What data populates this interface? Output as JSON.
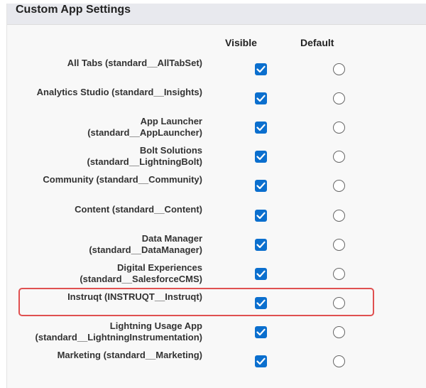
{
  "section": {
    "title": "Custom App Settings"
  },
  "columns": {
    "visible": "Visible",
    "default": "Default"
  },
  "apps": [
    {
      "line1": "All Tabs (standard__AllTabSet)",
      "line2": "",
      "visible": true,
      "default": false
    },
    {
      "line1": "Analytics Studio (standard__Insights)",
      "line2": "",
      "visible": true,
      "default": false
    },
    {
      "line1": "App Launcher",
      "line2": "(standard__AppLauncher)",
      "visible": true,
      "default": false
    },
    {
      "line1": "Bolt Solutions",
      "line2": "(standard__LightningBolt)",
      "visible": true,
      "default": false
    },
    {
      "line1": "Community (standard__Community)",
      "line2": "",
      "visible": true,
      "default": false
    },
    {
      "line1": "Content (standard__Content)",
      "line2": "",
      "visible": true,
      "default": false
    },
    {
      "line1": "Data Manager",
      "line2": "(standard__DataManager)",
      "visible": true,
      "default": false
    },
    {
      "line1": "Digital Experiences",
      "line2": "(standard__SalesforceCMS)",
      "visible": true,
      "default": false
    },
    {
      "line1": "Instruqt (INSTRUQT__Instruqt)",
      "line2": "",
      "visible": true,
      "default": false
    },
    {
      "line1": "Lightning Usage App",
      "line2": "(standard__LightningInstrumentation)",
      "visible": true,
      "default": false
    },
    {
      "line1": "Marketing (standard__Marketing)",
      "line2": "",
      "visible": true,
      "default": false
    }
  ],
  "highlighted_app": "Instruqt (INSTRUQT__Instruqt)",
  "colors": {
    "checkbox": "#0b6fce",
    "highlight": "#e05050"
  }
}
